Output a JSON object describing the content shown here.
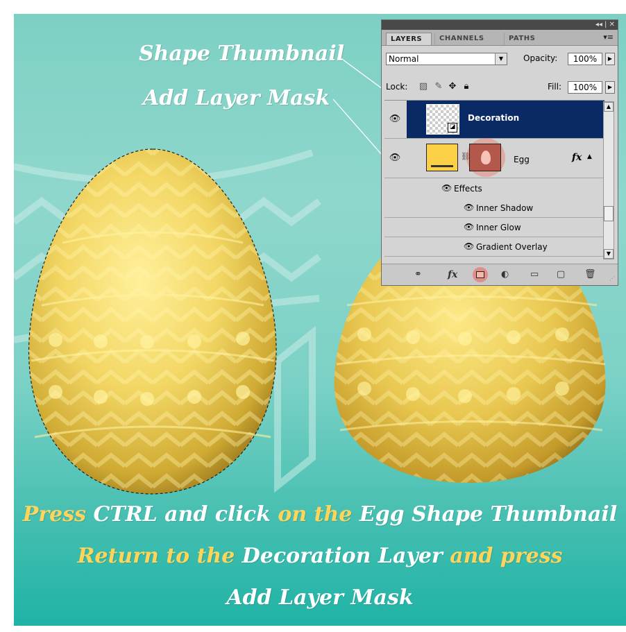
{
  "annotations": {
    "shape_thumbnail": "Shape Thumbnail",
    "add_layer_mask": "Add Layer Mask"
  },
  "instructions": {
    "line1": [
      {
        "text": "Press ",
        "color": "yellow"
      },
      {
        "text": "CTRL and click ",
        "color": "white"
      },
      {
        "text": "on the ",
        "color": "yellow"
      },
      {
        "text": "Egg Shape Thumbnail",
        "color": "white"
      }
    ],
    "line2": [
      {
        "text": "Return to the ",
        "color": "yellow"
      },
      {
        "text": "Decoration Layer ",
        "color": "white"
      },
      {
        "text": "and press",
        "color": "yellow"
      }
    ],
    "line3": [
      {
        "text": "Add Layer Mask",
        "color": "white"
      }
    ]
  },
  "colors": {
    "yellow": "#ffd45a",
    "white": "#ffffff",
    "selection": "#0a2a66",
    "egg_fill": "#fbcf46",
    "teal_top": "#7dd0c4",
    "teal_bottom": "#1fb3a5"
  },
  "layers_panel": {
    "titlebar_controls": "◂◂ | ✕",
    "tabs": [
      "LAYERS",
      "CHANNELS",
      "PATHS"
    ],
    "active_tab": "LAYERS",
    "menu_icon": "▾≡",
    "blend_mode": "Normal",
    "opacity_label": "Opacity:",
    "opacity_value": "100%",
    "lock_label": "Lock:",
    "fill_label": "Fill:",
    "fill_value": "100%",
    "layers": {
      "decoration": {
        "name": "Decoration",
        "selected": true
      },
      "egg": {
        "name": "Egg",
        "fx": "fx"
      }
    },
    "effects": {
      "header": "Effects",
      "items": [
        "Inner Shadow",
        "Inner Glow",
        "Gradient Overlay"
      ]
    },
    "bottom_bar_icons": [
      "link-icon",
      "fx-icon",
      "add-layer-mask-icon",
      "adjustment-icon",
      "folder-icon",
      "new-layer-icon",
      "trash-icon"
    ],
    "bottom_fx_label": "fx"
  }
}
